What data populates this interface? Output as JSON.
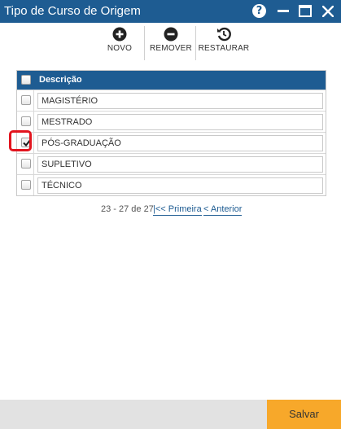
{
  "window": {
    "title": "Tipo de Curso de Origem",
    "help_label": "?"
  },
  "toolbar": {
    "novo_label": "NOVO",
    "remover_label": "REMOVER",
    "restaurar_label": "RESTAURAR"
  },
  "grid": {
    "header": "Descrição",
    "rows": [
      {
        "label": "MAGISTÉRIO",
        "checked": false
      },
      {
        "label": "MESTRADO",
        "checked": false
      },
      {
        "label": "PÓS-GRADUAÇÃO",
        "checked": true
      },
      {
        "label": "SUPLETIVO",
        "checked": false
      },
      {
        "label": "TÉCNICO",
        "checked": false
      }
    ]
  },
  "pager": {
    "range_text": "23 - 27 de 27",
    "first_label": "|<< Primeira",
    "prev_label": "< Anterior"
  },
  "footer": {
    "save_label": "Salvar"
  },
  "colors": {
    "accent": "#1e5c92",
    "save": "#f7a82a",
    "highlight": "#e2141e"
  }
}
